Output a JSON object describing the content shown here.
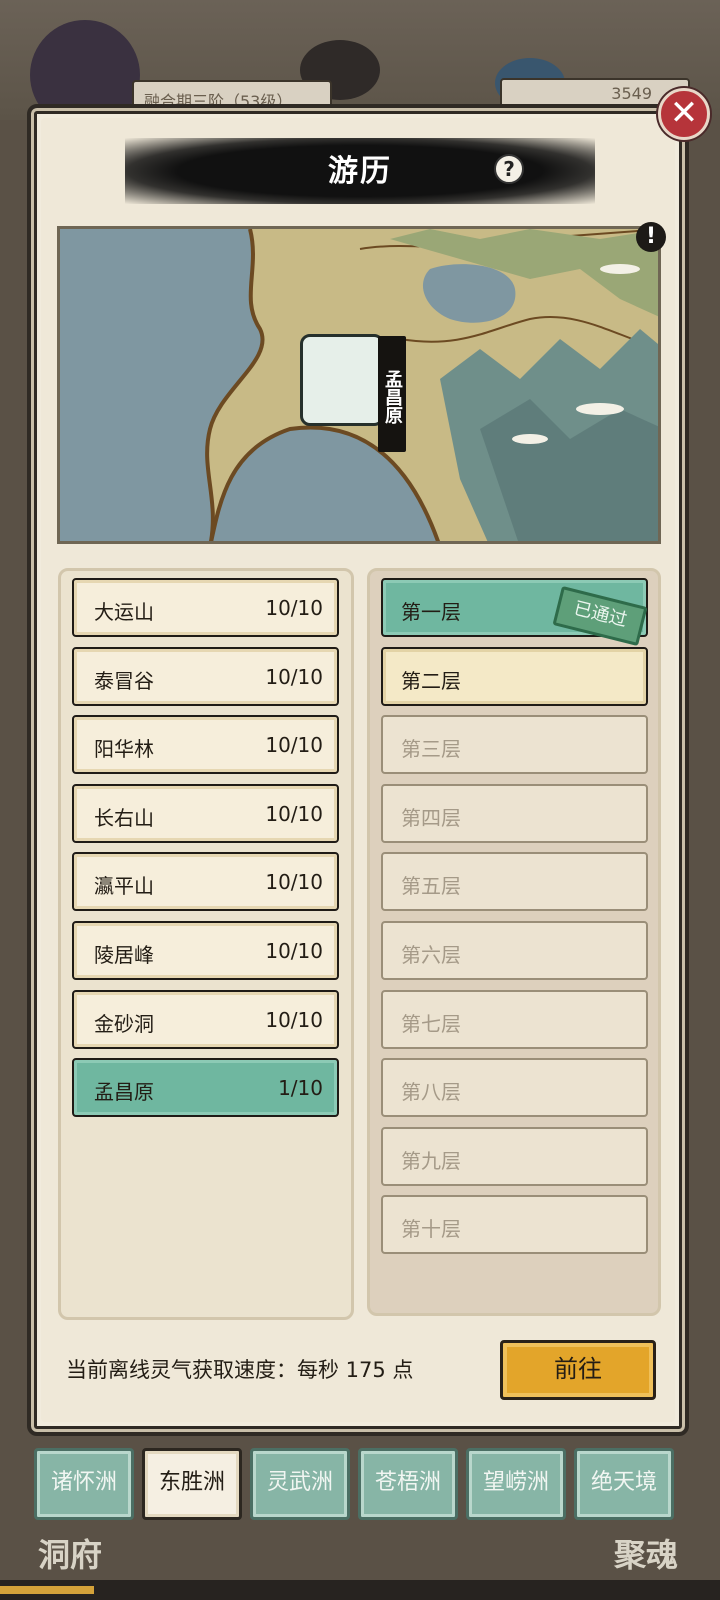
{
  "background": {
    "level_text": "融合期三阶（53级）",
    "number_text": "3549"
  },
  "panel": {
    "title": "游历",
    "help_icon": "question-icon",
    "close_icon": "close-icon"
  },
  "map": {
    "location_label": "孟昌原",
    "alert_icon": "!"
  },
  "regions": [
    {
      "name": "大运山",
      "progress": "10/10"
    },
    {
      "name": "泰冒谷",
      "progress": "10/10"
    },
    {
      "name": "阳华林",
      "progress": "10/10"
    },
    {
      "name": "长右山",
      "progress": "10/10"
    },
    {
      "name": "瀛平山",
      "progress": "10/10"
    },
    {
      "name": "陵居峰",
      "progress": "10/10"
    },
    {
      "name": "金砂洞",
      "progress": "10/10"
    },
    {
      "name": "孟昌原",
      "progress": "1/10"
    }
  ],
  "floors": [
    {
      "label": "第一层",
      "state": "passed"
    },
    {
      "label": "第二层",
      "state": "unlocked"
    },
    {
      "label": "第三层",
      "state": "locked"
    },
    {
      "label": "第四层",
      "state": "locked"
    },
    {
      "label": "第五层",
      "state": "locked"
    },
    {
      "label": "第六层",
      "state": "locked"
    },
    {
      "label": "第七层",
      "state": "locked"
    },
    {
      "label": "第八层",
      "state": "locked"
    },
    {
      "label": "第九层",
      "state": "locked"
    },
    {
      "label": "第十层",
      "state": "locked"
    }
  ],
  "passed_stamp": "已通过",
  "footer": {
    "offline_rate": "当前离线灵气获取速度：每秒 175 点",
    "go_button": "前往"
  },
  "tabs": [
    {
      "label": "诸怀洲",
      "selected": false
    },
    {
      "label": "东胜洲",
      "selected": true
    },
    {
      "label": "灵武洲",
      "selected": false
    },
    {
      "label": "苍梧洲",
      "selected": false
    },
    {
      "label": "望崂洲",
      "selected": false
    },
    {
      "label": "绝天境",
      "selected": false
    }
  ],
  "corner_labels": {
    "left": "洞府",
    "right": "聚魂"
  },
  "colors": {
    "active_green": "#6fb7a0",
    "go_button_gold": "#e3a52a",
    "close_red": "#b6343a"
  }
}
